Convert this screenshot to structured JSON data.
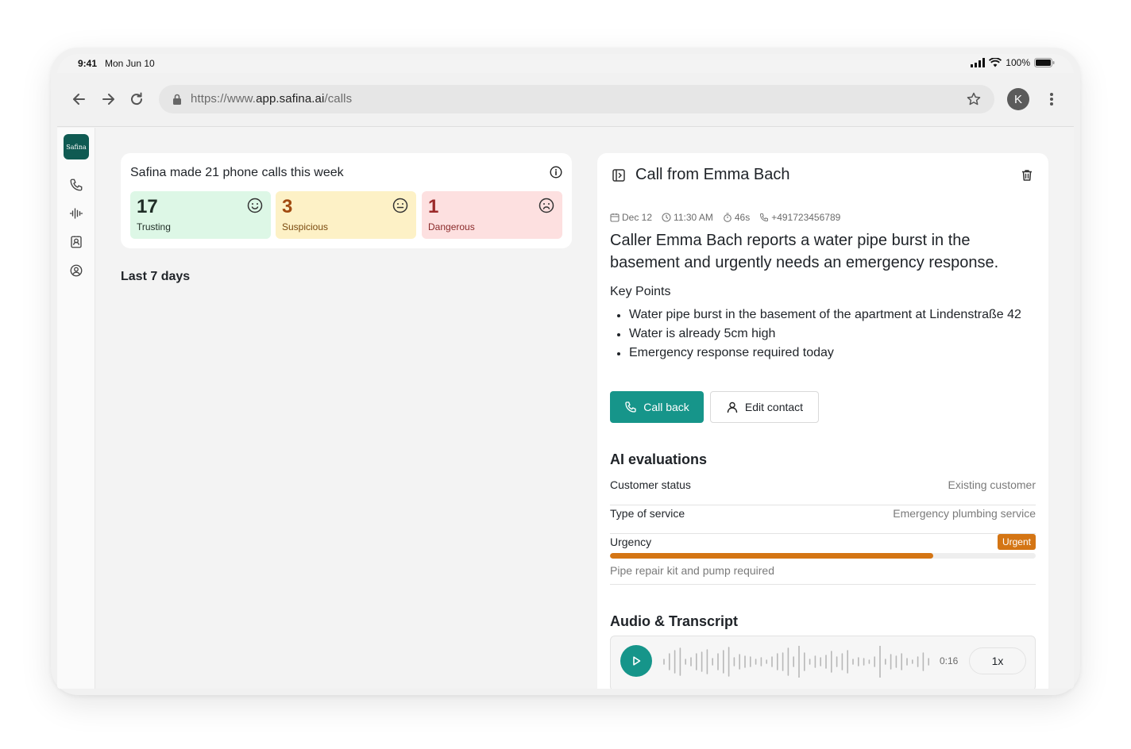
{
  "status_bar": {
    "time": "9:41",
    "date": "Mon Jun 10",
    "battery": "100%"
  },
  "browser": {
    "url_prefix": "https://www.",
    "url_host": "app.safina.ai",
    "url_path": "/calls",
    "profile_initial": "K"
  },
  "sidebar": {
    "logo_text": "Safina",
    "items": [
      {
        "icon": "phone-icon"
      },
      {
        "icon": "waveform-icon"
      },
      {
        "icon": "contact-card-icon"
      },
      {
        "icon": "user-circle-icon"
      }
    ]
  },
  "summary": {
    "title": "Safina made 21 phone calls this week",
    "stats": [
      {
        "count": "17",
        "label": "Trusting",
        "icon": "smile-face-icon",
        "color": "#ddf7e6"
      },
      {
        "count": "3",
        "label": "Suspicious",
        "icon": "neutral-face-icon",
        "color": "#fdf1c6"
      },
      {
        "count": "1",
        "label": "Dangerous",
        "icon": "sad-face-icon",
        "color": "#fde0e0"
      }
    ]
  },
  "last7_label": "Last 7 days",
  "call": {
    "title": "Call from Emma Bach",
    "meta": {
      "date": "Dec 12",
      "time": "11:30 AM",
      "duration": "46s",
      "phone": "+491723456789"
    },
    "summary": "Caller Emma Bach reports a water pipe burst in the basement and urgently needs an emergency response.",
    "key_points_title": "Key Points",
    "key_points": [
      "Water pipe burst in the basement of the apartment at Lindenstraße 42",
      "Water is already 5cm high",
      "Emergency response required today"
    ],
    "call_back_label": "Call back",
    "edit_contact_label": "Edit contact",
    "evaluations_title": "AI evaluations",
    "evaluations": [
      {
        "key": "Customer status",
        "value": "Existing customer"
      },
      {
        "key": "Type of service",
        "value": "Emergency plumbing service"
      }
    ],
    "urgency": {
      "key": "Urgency",
      "badge": "Urgent",
      "level": 0.76,
      "note": "Pipe repair kit and pump required",
      "color": "#d47514"
    },
    "audio_title": "Audio & Transcript",
    "audio": {
      "time": "0:16",
      "speed": "1x"
    }
  },
  "colors": {
    "accent": "#16958a",
    "brand": "#0f5a52"
  }
}
